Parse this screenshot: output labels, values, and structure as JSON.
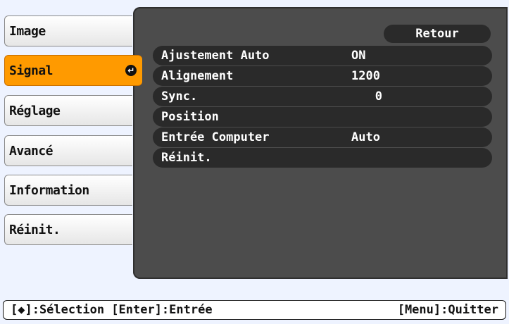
{
  "menu": {
    "items": [
      {
        "label": "Image"
      },
      {
        "label": "Signal",
        "selected": true
      },
      {
        "label": "Réglage"
      },
      {
        "label": "Avancé"
      },
      {
        "label": "Information"
      },
      {
        "label": "Réinit."
      }
    ]
  },
  "panel": {
    "back_label": "Retour",
    "rows": [
      {
        "label": "Ajustement Auto",
        "value": "ON"
      },
      {
        "label": "Alignement",
        "value": "1200"
      },
      {
        "label": "Sync.",
        "value": "0"
      },
      {
        "label": "Position",
        "value": ""
      },
      {
        "label": "Entrée Computer",
        "value": "Auto"
      },
      {
        "label": "Réinit.",
        "value": ""
      }
    ]
  },
  "footer": {
    "left_text": "[◆]:Sélection [Enter]:Entrée",
    "right_text": "[Menu]:Quitter"
  }
}
